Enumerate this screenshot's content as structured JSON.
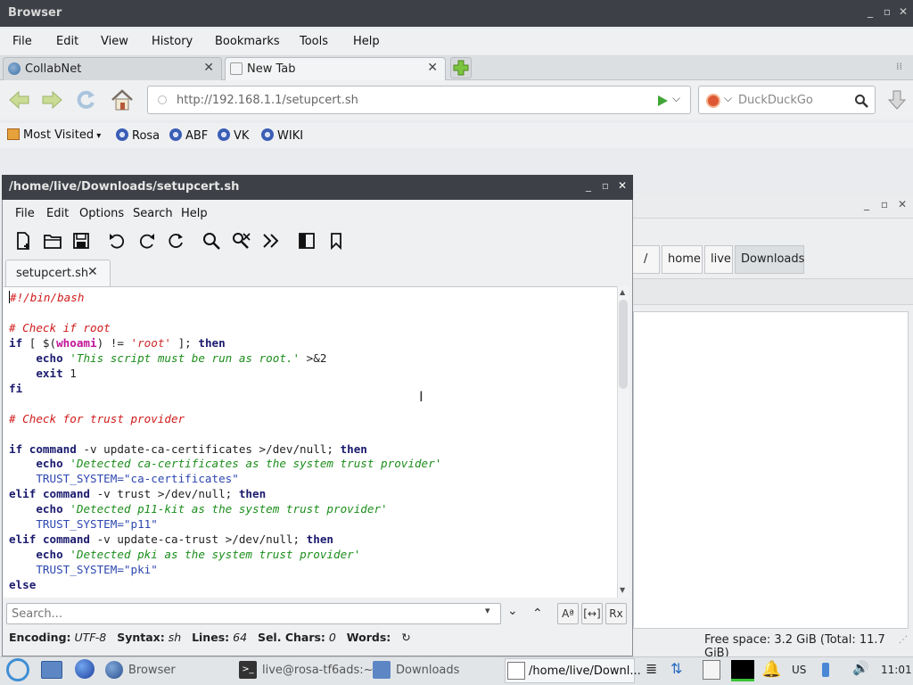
{
  "browser": {
    "title": "Browser",
    "menu": [
      "File",
      "Edit",
      "View",
      "History",
      "Bookmarks",
      "Tools",
      "Help"
    ],
    "tabs": [
      {
        "label": "CollabNet",
        "active": false
      },
      {
        "label": "New Tab",
        "active": true
      }
    ],
    "url": "http://192.168.1.1/setupcert.sh",
    "search_placeholder": "DuckDuckGo",
    "bookmarks": [
      "Most Visited",
      "Rosa",
      "ABF",
      "VK",
      "WIKI"
    ]
  },
  "file_manager": {
    "breadcrumbs": [
      "/",
      "home",
      "live",
      "Downloads"
    ],
    "status": "Free space: 3.2 GiB (Total: 11.7 GiB)"
  },
  "editor": {
    "title": "/home/live/Downloads/setupcert.sh",
    "menu": [
      "File",
      "Edit",
      "Options",
      "Search",
      "Help"
    ],
    "toolbar_icons": [
      "new-file-icon",
      "open-file-icon",
      "save-icon",
      "undo-icon",
      "redo-icon",
      "reload-icon",
      "find-icon",
      "clear-highlight-icon",
      "go-to-icon",
      "sidebar-icon",
      "bookmark-icon"
    ],
    "tab_label": "setupcert.sh",
    "code_lines": [
      "#!/bin/bash",
      "",
      "# Check if root",
      "if [ $(whoami) != 'root' ]; then",
      "    echo 'This script must be run as root.' >&2",
      "    exit 1",
      "fi",
      "",
      "# Check for trust provider",
      "",
      "if command -v update-ca-certificates >/dev/null; then",
      "    echo 'Detected ca-certificates as the system trust provider'",
      "    TRUST_SYSTEM=\"ca-certificates\"",
      "elif command -v trust >/dev/null; then",
      "    echo 'Detected p11-kit as the system trust provider'",
      "    TRUST_SYSTEM=\"p11\"",
      "elif command -v update-ca-trust >/dev/null; then",
      "    echo 'Detected pki as the system trust provider'",
      "    TRUST_SYSTEM=\"pki\"",
      "else"
    ],
    "find_placeholder": "Search...",
    "status": {
      "encoding_label": "Encoding:",
      "encoding": "UTF-8",
      "syntax_label": "Syntax:",
      "syntax": "sh",
      "lines_label": "Lines:",
      "lines": "64",
      "sel_label": "Sel. Chars:",
      "sel": "0",
      "words_label": "Words:"
    }
  },
  "taskbar": {
    "tasks": [
      {
        "label": "Browser",
        "active": false
      },
      {
        "label": "live@rosa-tf6ads:~",
        "active": false
      },
      {
        "label": "Downloads",
        "active": false
      },
      {
        "label": "/home/live/Downl...",
        "active": true
      }
    ],
    "keyboard_layout": "US",
    "clock": "11:01"
  },
  "colors": {
    "title_bar": "#3d4046",
    "keyword": "#1a1a6e",
    "comment": "#d01b1b",
    "string": "#1c8e1c",
    "variable": "#2d47b0"
  }
}
